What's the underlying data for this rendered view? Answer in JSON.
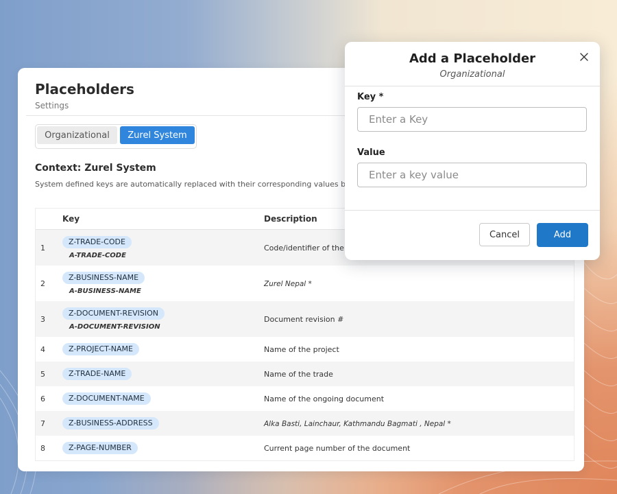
{
  "page": {
    "title": "Placeholders",
    "subtitle": "Settings",
    "tabs": [
      {
        "label": "Organizational",
        "active": false
      },
      {
        "label": "Zurel System",
        "active": true
      }
    ],
    "context_title": "Context: Zurel System",
    "context_desc": "System defined keys are automatically replaced with their corresponding values base"
  },
  "table": {
    "headers": {
      "key": "Key",
      "description": "Description"
    },
    "rows": [
      {
        "index": "1",
        "key": "Z-TRADE-CODE",
        "alias": "A-TRADE-CODE",
        "description": "Code/identifier of the tr"
      },
      {
        "index": "2",
        "key": "Z-BUSINESS-NAME",
        "alias": "A-BUSINESS-NAME",
        "description": "Zurel Nepal *"
      },
      {
        "index": "3",
        "key": "Z-DOCUMENT-REVISION",
        "alias": "A-DOCUMENT-REVISION",
        "description": "Document revision #"
      },
      {
        "index": "4",
        "key": "Z-PROJECT-NAME",
        "description": "Name of the project"
      },
      {
        "index": "5",
        "key": "Z-TRADE-NAME",
        "description": "Name of the trade"
      },
      {
        "index": "6",
        "key": "Z-DOCUMENT-NAME",
        "description": "Name of the ongoing document"
      },
      {
        "index": "7",
        "key": "Z-BUSINESS-ADDRESS",
        "description": "Alka Basti, Lainchaur, Kathmandu Bagmati , Nepal *"
      },
      {
        "index": "8",
        "key": "Z-PAGE-NUMBER",
        "description": "Current page number of the document"
      }
    ]
  },
  "modal": {
    "title": "Add a Placeholder",
    "subtitle": "Organizational",
    "close_icon": "close-icon",
    "key_label": "Key *",
    "key_placeholder": "Enter a Key",
    "value_label": "Value",
    "value_placeholder": "Enter a key value",
    "cancel_label": "Cancel",
    "add_label": "Add"
  },
  "colors": {
    "accent": "#2f86dc",
    "add_button": "#1f78c8",
    "pill": "#d5e8fb"
  }
}
